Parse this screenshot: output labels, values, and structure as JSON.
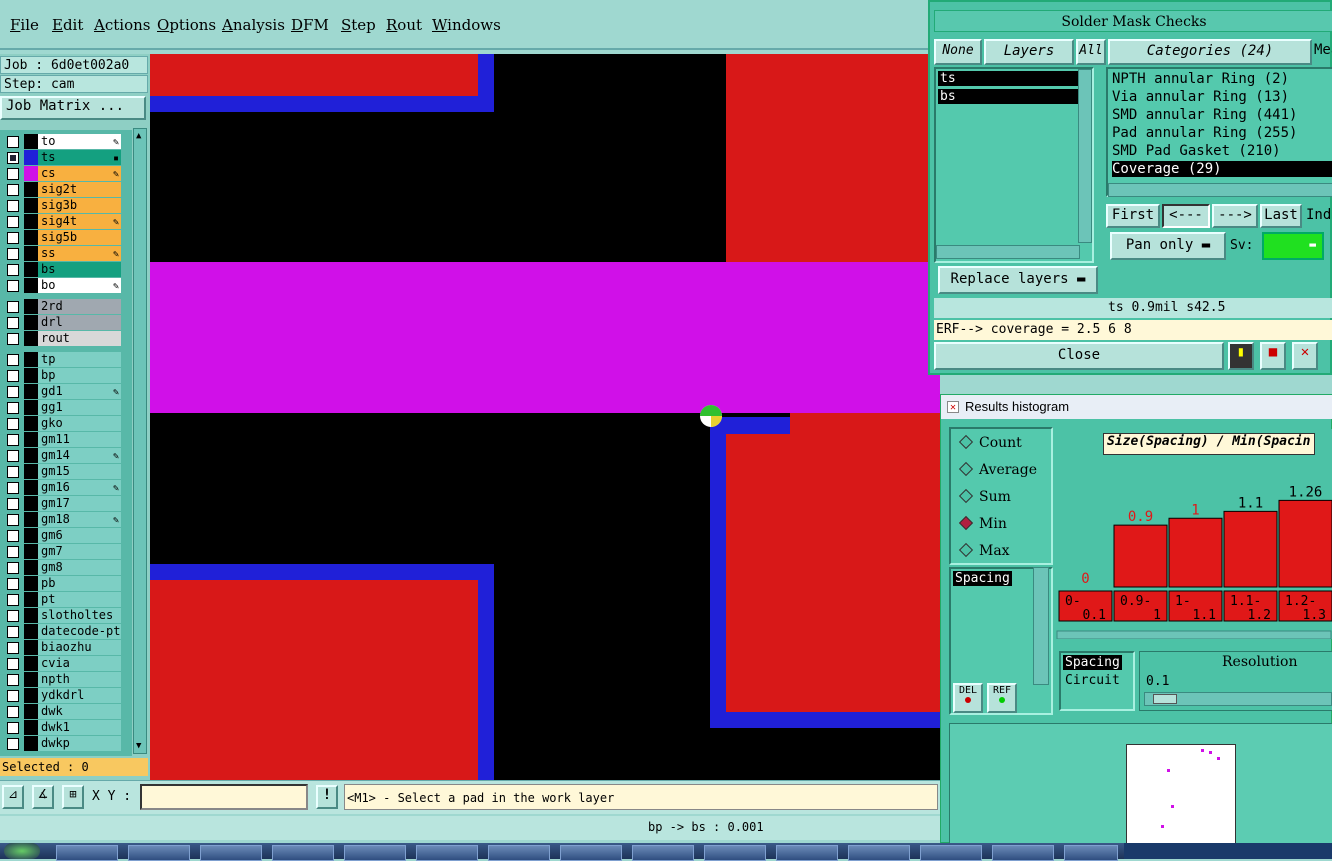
{
  "menu": {
    "items": [
      {
        "label": "File",
        "u": "F",
        "rest": "ile"
      },
      {
        "label": "Edit",
        "u": "E",
        "rest": "dit"
      },
      {
        "label": "Actions",
        "u": "A",
        "rest": "ctions"
      },
      {
        "label": "Options",
        "u": "O",
        "rest": "ptions"
      },
      {
        "label": "Analysis",
        "u": "A",
        "rest": "nalysis"
      },
      {
        "label": "DFM",
        "u": "D",
        "rest": "FM"
      },
      {
        "label": "Step",
        "u": "S",
        "rest": "tep"
      },
      {
        "label": "Rout",
        "u": "R",
        "rest": "out"
      },
      {
        "label": "Windows",
        "u": "W",
        "rest": "indows"
      }
    ]
  },
  "job": {
    "job_label": "Job : 6d0et002a0",
    "step_label": "Step: cam",
    "matrix_button": "Job Matrix ..."
  },
  "layers": [
    {
      "name": "to",
      "bg": "#ffffff",
      "swatch": "#000000",
      "edit": true,
      "checked": false
    },
    {
      "name": "ts",
      "bg": "#14a080",
      "swatch": "#2020d8",
      "edit": false,
      "checked": true,
      "marker": true
    },
    {
      "name": "cs",
      "bg": "#f8b040",
      "swatch": "#d010e8",
      "edit": true,
      "checked": false
    },
    {
      "name": "sig2t",
      "bg": "#f8b040",
      "swatch": "#000000",
      "edit": false,
      "checked": false
    },
    {
      "name": "sig3b",
      "bg": "#f8b040",
      "swatch": "#000000",
      "edit": false,
      "checked": false
    },
    {
      "name": "sig4t",
      "bg": "#f8b040",
      "swatch": "#000000",
      "edit": true,
      "checked": false
    },
    {
      "name": "sig5b",
      "bg": "#f8b040",
      "swatch": "#000000",
      "edit": false,
      "checked": false
    },
    {
      "name": "ss",
      "bg": "#f8b040",
      "swatch": "#000000",
      "edit": true,
      "checked": false
    },
    {
      "name": "bs",
      "bg": "#14a080",
      "swatch": "#000000",
      "edit": false,
      "checked": false
    },
    {
      "name": "bo",
      "bg": "#ffffff",
      "swatch": "#000000",
      "edit": true,
      "checked": false
    },
    {
      "name": "2rd",
      "bg": "#a0a8b0",
      "swatch": "#000000",
      "edit": false,
      "checked": false
    },
    {
      "name": "drl",
      "bg": "#a0a8b0",
      "swatch": "#000000",
      "edit": false,
      "checked": false
    },
    {
      "name": "rout",
      "bg": "#d8d8d8",
      "swatch": "#000000",
      "edit": false,
      "checked": false
    },
    {
      "name": "tp",
      "bg": "#7dcfc4",
      "swatch": "#000000",
      "edit": false,
      "checked": false
    },
    {
      "name": "bp",
      "bg": "#7dcfc4",
      "swatch": "#000000",
      "edit": false,
      "checked": false
    },
    {
      "name": "gd1",
      "bg": "#7dcfc4",
      "swatch": "#000000",
      "edit": true,
      "checked": false
    },
    {
      "name": "gg1",
      "bg": "#7dcfc4",
      "swatch": "#000000",
      "edit": false,
      "checked": false
    },
    {
      "name": "gko",
      "bg": "#7dcfc4",
      "swatch": "#000000",
      "edit": false,
      "checked": false
    },
    {
      "name": "gm11",
      "bg": "#7dcfc4",
      "swatch": "#000000",
      "edit": false,
      "checked": false
    },
    {
      "name": "gm14",
      "bg": "#7dcfc4",
      "swatch": "#000000",
      "edit": true,
      "checked": false
    },
    {
      "name": "gm15",
      "bg": "#7dcfc4",
      "swatch": "#000000",
      "edit": false,
      "checked": false
    },
    {
      "name": "gm16",
      "bg": "#7dcfc4",
      "swatch": "#000000",
      "edit": true,
      "checked": false
    },
    {
      "name": "gm17",
      "bg": "#7dcfc4",
      "swatch": "#000000",
      "edit": false,
      "checked": false
    },
    {
      "name": "gm18",
      "bg": "#7dcfc4",
      "swatch": "#000000",
      "edit": true,
      "checked": false
    },
    {
      "name": "gm6",
      "bg": "#7dcfc4",
      "swatch": "#000000",
      "edit": false,
      "checked": false
    },
    {
      "name": "gm7",
      "bg": "#7dcfc4",
      "swatch": "#000000",
      "edit": false,
      "checked": false
    },
    {
      "name": "gm8",
      "bg": "#7dcfc4",
      "swatch": "#000000",
      "edit": false,
      "checked": false
    },
    {
      "name": "pb",
      "bg": "#7dcfc4",
      "swatch": "#000000",
      "edit": false,
      "checked": false
    },
    {
      "name": "pt",
      "bg": "#7dcfc4",
      "swatch": "#000000",
      "edit": false,
      "checked": false
    },
    {
      "name": "slotholtes",
      "bg": "#7dcfc4",
      "swatch": "#000000",
      "edit": false,
      "checked": false
    },
    {
      "name": "datecode-pto",
      "bg": "#7dcfc4",
      "swatch": "#000000",
      "edit": false,
      "checked": false
    },
    {
      "name": "biaozhu",
      "bg": "#7dcfc4",
      "swatch": "#000000",
      "edit": false,
      "checked": false
    },
    {
      "name": "cvia",
      "bg": "#7dcfc4",
      "swatch": "#000000",
      "edit": false,
      "checked": false
    },
    {
      "name": "npth",
      "bg": "#7dcfc4",
      "swatch": "#000000",
      "edit": false,
      "checked": false
    },
    {
      "name": "ydkdrl",
      "bg": "#7dcfc4",
      "swatch": "#000000",
      "edit": false,
      "checked": false
    },
    {
      "name": "dwk",
      "bg": "#7dcfc4",
      "swatch": "#000000",
      "edit": false,
      "checked": false
    },
    {
      "name": "dwk1",
      "bg": "#7dcfc4",
      "swatch": "#000000",
      "edit": false,
      "checked": false
    },
    {
      "name": "dwkp",
      "bg": "#7dcfc4",
      "swatch": "#000000",
      "edit": false,
      "checked": false
    }
  ],
  "selected_label": "Selected : 0",
  "status": {
    "xy_label": "X Y :",
    "xy_value": "",
    "prompt": "<M1> - Select a pad in the work layer"
  },
  "bottom_status": "bp -> bs : 0.001",
  "solder_mask": {
    "title": "Solder Mask Checks",
    "none_btn": "None",
    "layers_btn": "Layers",
    "all_btn": "All",
    "categories_btn": "Categories (24)",
    "meas_btn": "Mea",
    "layer_list": [
      "ts",
      "bs"
    ],
    "categories": [
      "NPTH annular Ring (2)",
      "Via annular Ring (13)",
      "SMD annular Ring (441)",
      "Pad annular Ring (255)",
      "SMD Pad Gasket (210)",
      "Coverage (29)"
    ],
    "selected_category": "Coverage (29)",
    "first_btn": "First",
    "prev_btn": "<---",
    "next_btn": "--->",
    "last_btn": "Last",
    "ind_btn": "Ind",
    "pan_option": "Pan only",
    "sv_label": "Sv:",
    "replace_layers": "Replace layers",
    "info_line": "ts 0.9mil  s42.5",
    "erf_line": "ERF--> coverage = 2.5 6 8",
    "close_btn": "Close"
  },
  "histogram": {
    "title": "Results histogram",
    "modes": [
      {
        "label": "Count",
        "selected": false
      },
      {
        "label": "Average",
        "selected": false
      },
      {
        "label": "Sum",
        "selected": false
      },
      {
        "label": "Min",
        "selected": true
      },
      {
        "label": "Max",
        "selected": false
      }
    ],
    "list_item": "Spacing",
    "del_btn": "DEL",
    "ref_btn": "REF",
    "header": "Size(Spacing) / Min(Spacin",
    "resolution_label": "Resolution",
    "resolution_value": "0.1",
    "type_list": [
      "Spacing",
      "Circuit"
    ],
    "accent": "#e01818"
  },
  "chart_data": {
    "type": "bar",
    "title": "Size(Spacing) / Min(Spacin",
    "categories": [
      "0-0.1",
      "0.9-1",
      "1-1.1",
      "1.1-1.2",
      "1.2-1.3"
    ],
    "values": [
      0,
      0.9,
      1,
      1.1,
      1.26
    ],
    "value_labels": [
      "0",
      "0.9",
      "1",
      "1.1",
      "1.26"
    ],
    "category_top": [
      "0-",
      "0.9-",
      "1-",
      "1.1-",
      "1.2-"
    ],
    "category_bottom": [
      "0.1",
      "1",
      "1.1",
      "1.2",
      "1.3"
    ],
    "ylim": [
      0,
      1.6
    ]
  }
}
